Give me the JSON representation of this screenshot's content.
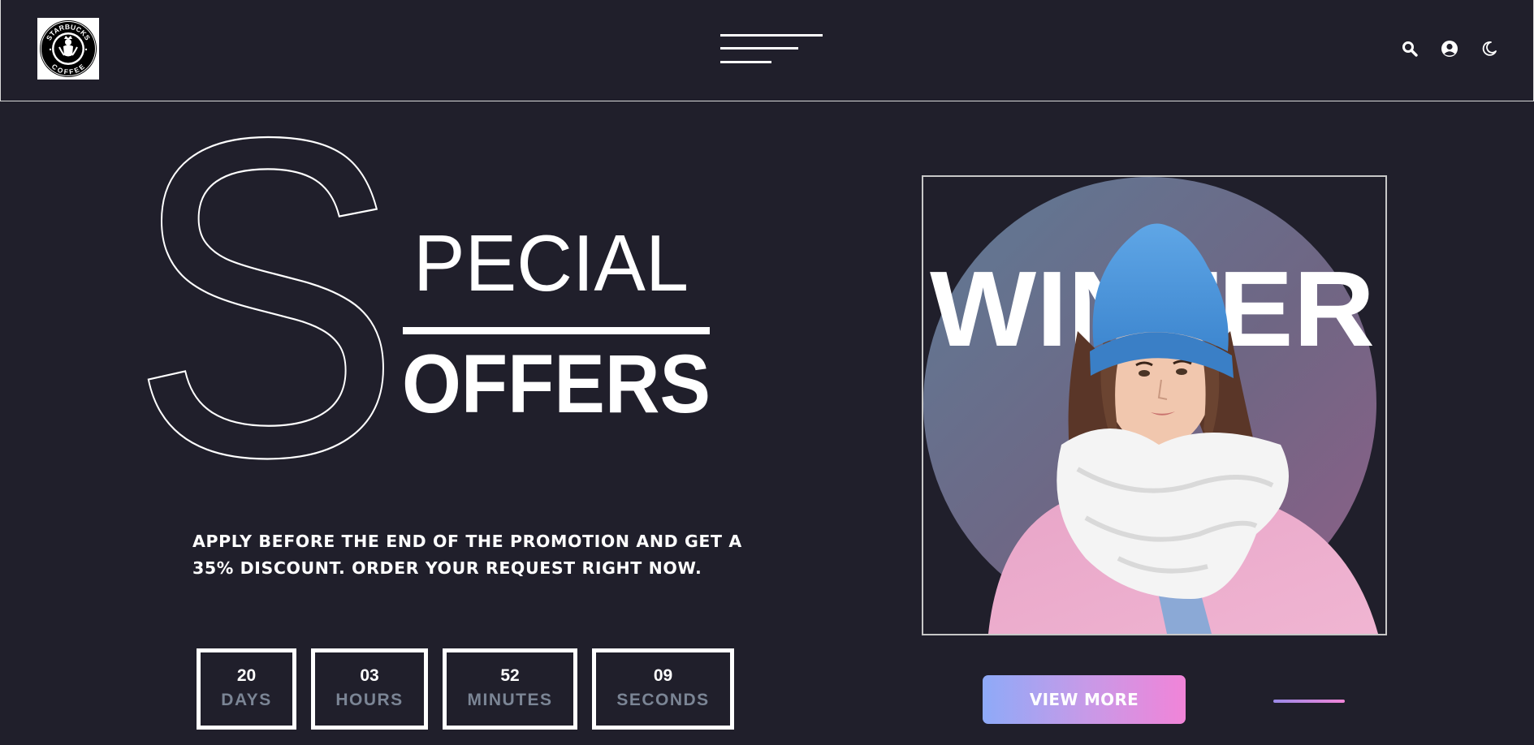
{
  "header": {
    "logo": {
      "ring_text_top": "STARBUCKS",
      "ring_text_bottom": "COFFEE"
    },
    "menu_icon": "hamburger-menu-icon",
    "actions": [
      {
        "icon": "search-icon"
      },
      {
        "icon": "user-circle-icon"
      },
      {
        "icon": "moon-icon"
      }
    ]
  },
  "hero": {
    "big_letter": "S",
    "line1": "PECIAL",
    "line2": "OFFERS",
    "promo_line1": "Apply before the end of the promotion and get a",
    "promo_line2": "35% discount. Order your request right now."
  },
  "countdown": {
    "days": {
      "value": "20",
      "label": "DAYS"
    },
    "hours": {
      "value": "03",
      "label": "HOURS"
    },
    "minutes": {
      "value": "52",
      "label": "MINUTES"
    },
    "seconds": {
      "value": "09",
      "label": "SECONDS"
    }
  },
  "product": {
    "headline": "WINTER"
  },
  "cta": {
    "view_more": "VIEW MORE"
  },
  "colors": {
    "background": "#201f2b",
    "text": "#ffffff",
    "muted": "#7b8595",
    "gradient_start": "#8eaaf8",
    "gradient_end": "#f184d8"
  }
}
